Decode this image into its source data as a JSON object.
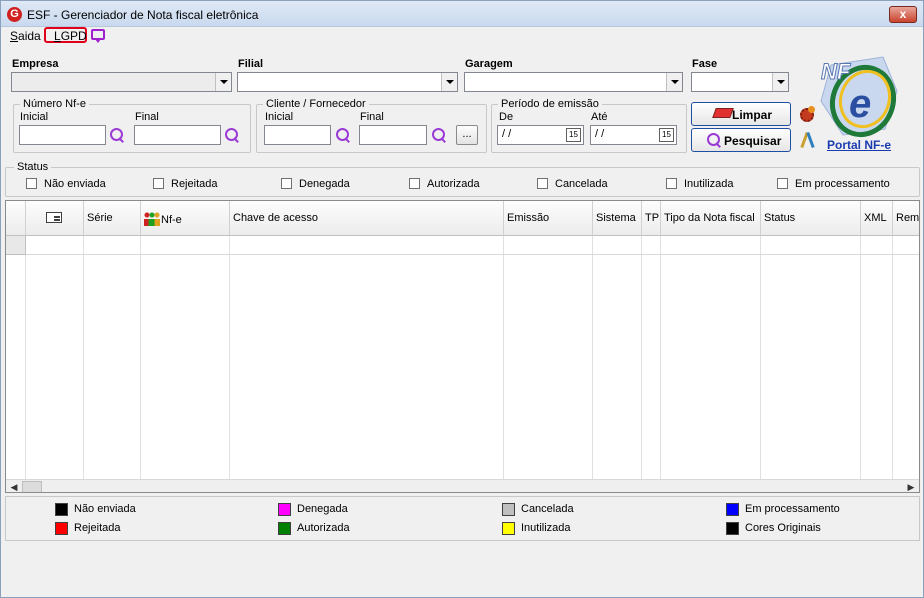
{
  "window": {
    "title": "ESF - Gerenciador de Nota fiscal eletrônica",
    "close_label": "x",
    "app_icon": "G"
  },
  "menu": {
    "saida": "Saida",
    "saida_key": "S",
    "saida_rest": "aida",
    "lgpd": "LGPD",
    "lgpd_key": "L",
    "lgpd_rest": "GPD"
  },
  "filters": {
    "empresa_label": "Empresa",
    "filial_label": "Filial",
    "garagem_label": "Garagem",
    "fase_label": "Fase",
    "numero_group": "Número Nf-e",
    "inicial_label": "Inicial",
    "final_label": "Final",
    "cliente_group": "Cliente / Fornecedor",
    "cliente_inicial_label": "Inicial",
    "cliente_final_label": "Final",
    "ellipsis": "...",
    "periodo_group": "Período de emissão",
    "de_label": "De",
    "ate_label": "Até",
    "de_value": " / /",
    "ate_value": " / /",
    "cal_label": "15"
  },
  "buttons": {
    "limpar": "Limpar",
    "pesquisar": "Pesquisar"
  },
  "portal": {
    "link": "Portal NF-e",
    "logo_text": "NF",
    "logo_e": "e"
  },
  "status": {
    "title": "Status",
    "options": [
      "Não enviada",
      "Rejeitada",
      "Denegada",
      "Autorizada",
      "Cancelada",
      "Inutilizada",
      "Em processamento"
    ]
  },
  "grid": {
    "columns": [
      "",
      "Série",
      "Nf-e",
      "Chave de acesso",
      "Emissão",
      "Sistema",
      "TP",
      "Tipo da Nota fiscal",
      "Status",
      "XML",
      "Reme"
    ]
  },
  "legend": [
    {
      "label": "Não enviada",
      "color": "#000000"
    },
    {
      "label": "Rejeitada",
      "color": "#ff0000"
    },
    {
      "label": "Denegada",
      "color": "#ff00ff"
    },
    {
      "label": "Autorizada",
      "color": "#008000"
    },
    {
      "label": "Cancelada",
      "color": "#c0c0c0"
    },
    {
      "label": "Inutilizada",
      "color": "#ffff00"
    },
    {
      "label": "Em processamento",
      "color": "#0000ff"
    },
    {
      "label": "Cores Originais",
      "color": "#000000"
    }
  ]
}
